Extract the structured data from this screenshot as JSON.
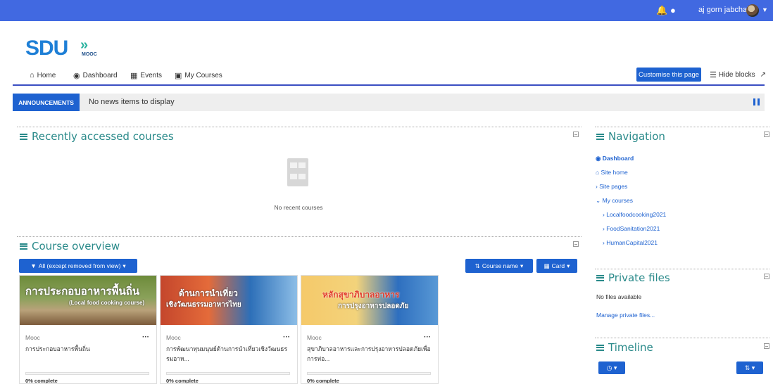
{
  "topbar": {
    "user_name": "aj gorn jabchai",
    "icons": [
      "bell-icon",
      "chat-icon",
      "avatar",
      "caret-down-icon"
    ]
  },
  "logo": {
    "main": "SDU",
    "arrows": "»",
    "sub": "MOOC"
  },
  "nav": {
    "home": "Home",
    "dashboard": "Dashboard",
    "events": "Events",
    "my_courses": "My Courses",
    "customise": "Customise this page",
    "hide_blocks": "Hide blocks"
  },
  "announcements": {
    "tag": "ANNOUNCEMENTS",
    "text": "No news items to display"
  },
  "recent": {
    "title": "Recently accessed courses",
    "empty": "No recent courses"
  },
  "overview": {
    "title": "Course overview",
    "filter": "All (except removed from view)",
    "sort": "Course name",
    "view": "Card",
    "cards": [
      {
        "category": "Mooc",
        "name": "การประกอบอาหารพื้นถิ่น",
        "image_text": "การประกอบอาหารพื้นถิ่น",
        "image_sub": "(Local food cooking course)",
        "progress": "0% complete",
        "progress_value": 0
      },
      {
        "category": "Mooc",
        "name": "การพัฒนาทุนมนุษย์ด้านการนำเที่ยวเชิงวัฒนธรรมอาห...",
        "image_text": "ด้านการนำเที่ยว",
        "image_sub": "เชิงวัฒนธรรมอาหารไทย",
        "progress": "0% complete",
        "progress_value": 0
      },
      {
        "category": "Mooc",
        "name": "สุขาภิบาลอาหารและการปรุงอาหารปลอดภัยเพื่อการท่อ...",
        "image_text": "หลักสุขาภิบาลอาหาร",
        "image_sub": "การปรุงอาหารปลอดภัย",
        "progress": "0% complete",
        "progress_value": 0
      }
    ]
  },
  "navigation": {
    "title": "Navigation",
    "dashboard": "Dashboard",
    "site_home": "Site home",
    "site_pages": "Site pages",
    "my_courses": "My courses",
    "courses": [
      "Localfoodcooking2021",
      "FoodSanitation2021",
      "HumanCapital2021"
    ]
  },
  "private_files": {
    "title": "Private files",
    "empty": "No files available",
    "manage": "Manage private files..."
  },
  "timeline": {
    "title": "Timeline"
  },
  "colors": {
    "topbar": "#4169e1",
    "accent": "#1e62d0",
    "heading": "#2a8a8a"
  }
}
